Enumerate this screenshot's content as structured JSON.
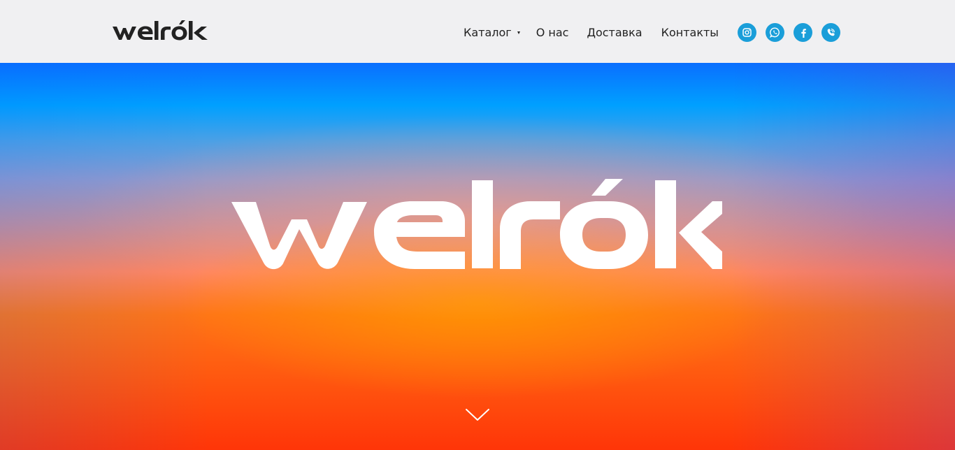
{
  "header": {
    "logo_text": "welrók",
    "nav": {
      "catalog": "Каталог",
      "about": "О нас",
      "delivery": "Доставка",
      "contacts": "Контакты"
    },
    "socials": [
      {
        "name": "instagram-icon"
      },
      {
        "name": "whatsapp-icon"
      },
      {
        "name": "facebook-icon"
      },
      {
        "name": "viber-icon"
      }
    ],
    "social_color": "#1a9ed9"
  },
  "hero": {
    "logo_text": "welrók",
    "scroll_icon": "chevron-down-icon",
    "colors": {
      "top": "#0a6fff",
      "middle": "#ff8560",
      "bottom": "#ff3508"
    }
  }
}
